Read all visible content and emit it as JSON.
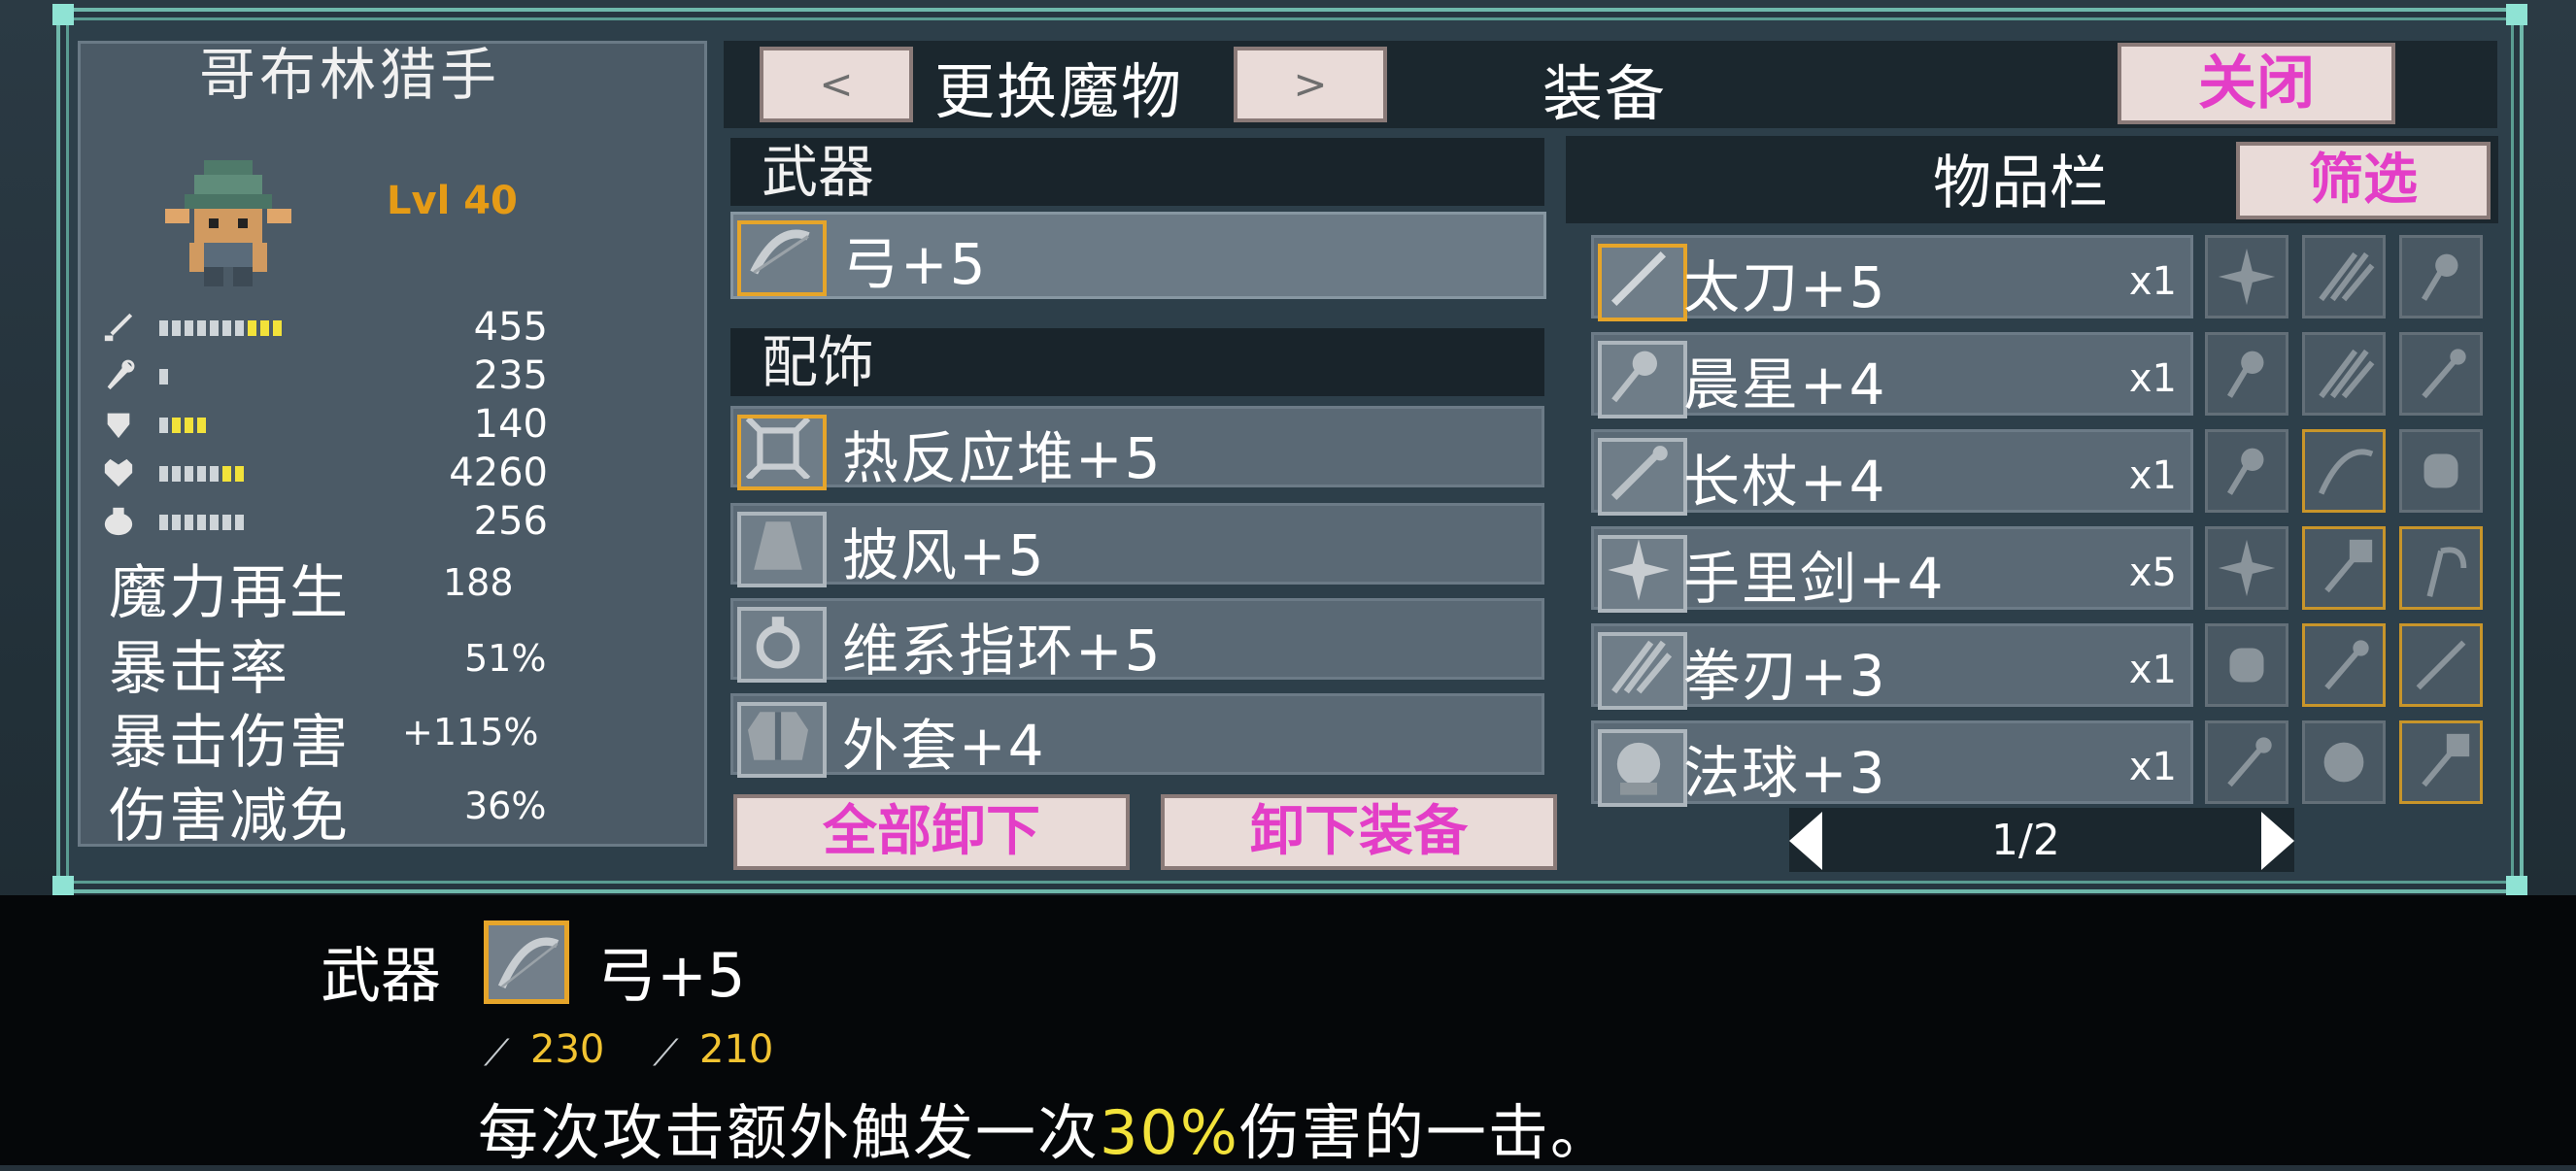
{
  "monster": {
    "name": "哥布林猎手",
    "level": "Lvl 40"
  },
  "stats": [
    {
      "icon": "sword-icon",
      "value": "455"
    },
    {
      "icon": "staff-icon",
      "value": "235"
    },
    {
      "icon": "shield-icon",
      "value": "140"
    },
    {
      "icon": "heart-icon",
      "value": "4260"
    },
    {
      "icon": "potion-icon",
      "value": "256"
    }
  ],
  "attributes": [
    {
      "label": "魔力再生",
      "value": "188"
    },
    {
      "label": "暴击率",
      "value": "51%"
    },
    {
      "label": "暴击伤害",
      "value": "+115%"
    },
    {
      "label": "伤害减免",
      "value": "36%"
    }
  ],
  "topbar": {
    "prev": "<",
    "change_monster": "更换魔物",
    "next": ">",
    "equip_title": "装备",
    "close": "关闭"
  },
  "equipment": {
    "weapon_header": "武器",
    "weapon": {
      "label": "弓+5",
      "icon": "bow-icon"
    },
    "accessory_header": "配饰",
    "accessories": [
      {
        "label": "热反应堆+5",
        "icon": "reactor-icon"
      },
      {
        "label": "披风+5",
        "icon": "cloak-icon"
      },
      {
        "label": "维系指环+5",
        "icon": "ring-icon"
      },
      {
        "label": "外套+4",
        "icon": "coat-icon"
      }
    ],
    "unequip_all": "全部卸下",
    "unequip": "卸下装备"
  },
  "inventory": {
    "title": "物品栏",
    "filter": "筛选",
    "items": [
      {
        "label": "太刀+5",
        "qty": "x1",
        "icon": "katana-icon"
      },
      {
        "label": "晨星+4",
        "qty": "x1",
        "icon": "morningstar-icon"
      },
      {
        "label": "长杖+4",
        "qty": "x1",
        "icon": "long-staff-icon"
      },
      {
        "label": "手里剑+4",
        "qty": "x5",
        "icon": "shuriken-icon"
      },
      {
        "label": "拳刃+3",
        "qty": "x1",
        "icon": "claw-blade-icon"
      },
      {
        "label": "法球+3",
        "qty": "x1",
        "icon": "orb-icon"
      }
    ],
    "page": "1/2"
  },
  "tooltip": {
    "type": "武器",
    "name": "弓+5",
    "attack": "230",
    "magic_attack": "210",
    "desc_before": "每次攻击额外触发一次",
    "desc_highlight": "30%",
    "desc_after": "伤害的一击。"
  },
  "colors": {
    "accent_pink": "#e33ec7",
    "gold": "#e6a52a",
    "level": "#e59b16",
    "highlight": "#f2e23a"
  }
}
